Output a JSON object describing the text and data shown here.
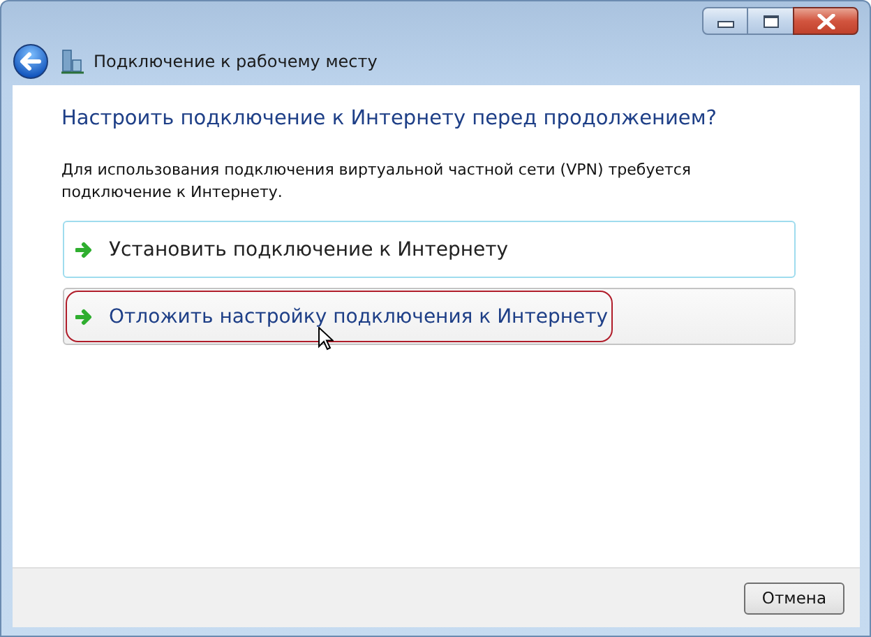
{
  "window": {
    "title": "Подключение к рабочему месту"
  },
  "heading": "Настроить подключение к Интернету перед продолжением?",
  "description": "Для использования подключения виртуальной частной сети (VPN) требуется подключение к Интернету.",
  "options": [
    {
      "label": "Установить подключение к Интернету",
      "hovered": false,
      "focused": true,
      "circled": false
    },
    {
      "label": "Отложить настройку подключения к Интернету",
      "hovered": true,
      "focused": false,
      "circled": true
    }
  ],
  "buttons": [
    {
      "label": "Отмена"
    }
  ]
}
